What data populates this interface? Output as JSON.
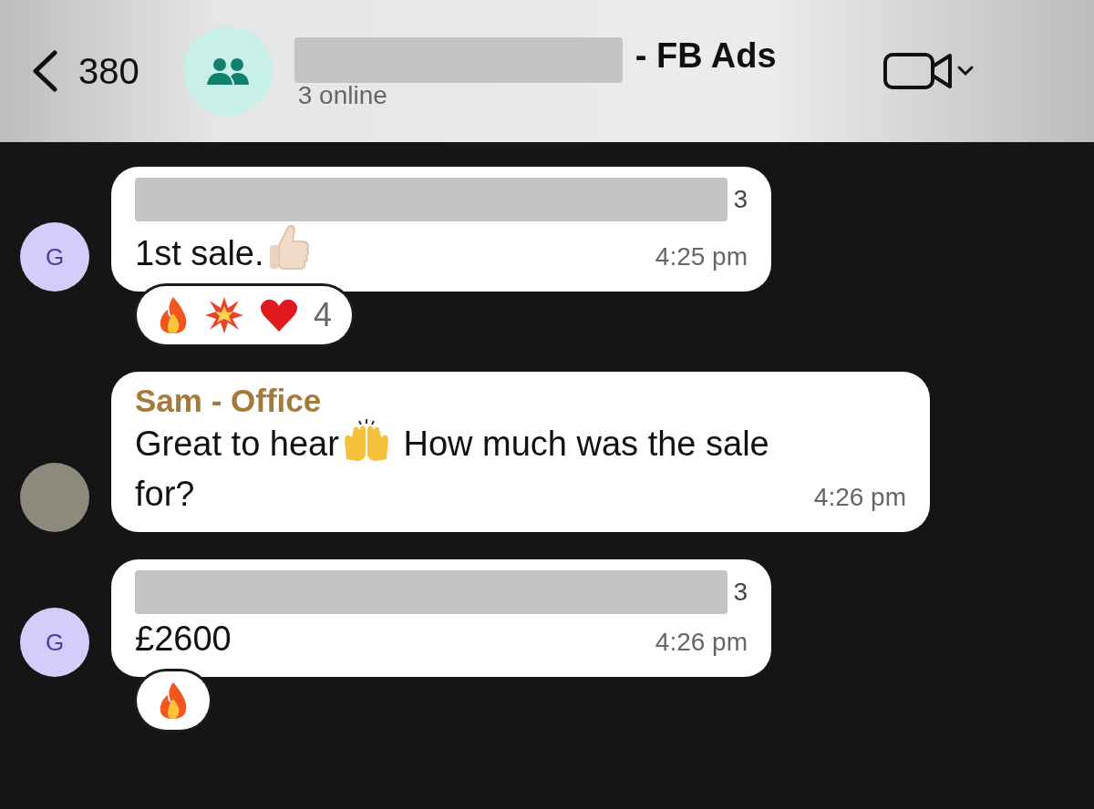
{
  "header": {
    "back_count": "380",
    "title_redacted": true,
    "title_suffix": "- FB Ads",
    "subtitle": "3 online"
  },
  "messages": [
    {
      "avatar": {
        "kind": "letter",
        "text": "G"
      },
      "sender": {
        "kind": "redacted",
        "suffix": "3"
      },
      "body": [
        {
          "kind": "text",
          "text": "1st sale."
        },
        {
          "kind": "thumbs_up"
        }
      ],
      "time": "4:25 pm",
      "reactions": {
        "items": [
          {
            "kind": "fire"
          },
          {
            "kind": "burst"
          },
          {
            "kind": "heart"
          }
        ],
        "count": "4"
      }
    },
    {
      "avatar": {
        "kind": "photo"
      },
      "sender": {
        "kind": "name",
        "text": "Sam - Office"
      },
      "body": [
        {
          "kind": "text",
          "text": "Great to hear"
        },
        {
          "kind": "raised_hands"
        },
        {
          "kind": "text",
          "text": "How much was the sale for?"
        }
      ],
      "time": "4:26 pm"
    },
    {
      "avatar": {
        "kind": "letter",
        "text": "G"
      },
      "sender": {
        "kind": "redacted",
        "suffix": "3"
      },
      "body": [
        {
          "kind": "text",
          "text": "£2600"
        }
      ],
      "time": "4:26 pm",
      "reactions": {
        "items": [
          {
            "kind": "fire"
          }
        ]
      }
    }
  ]
}
